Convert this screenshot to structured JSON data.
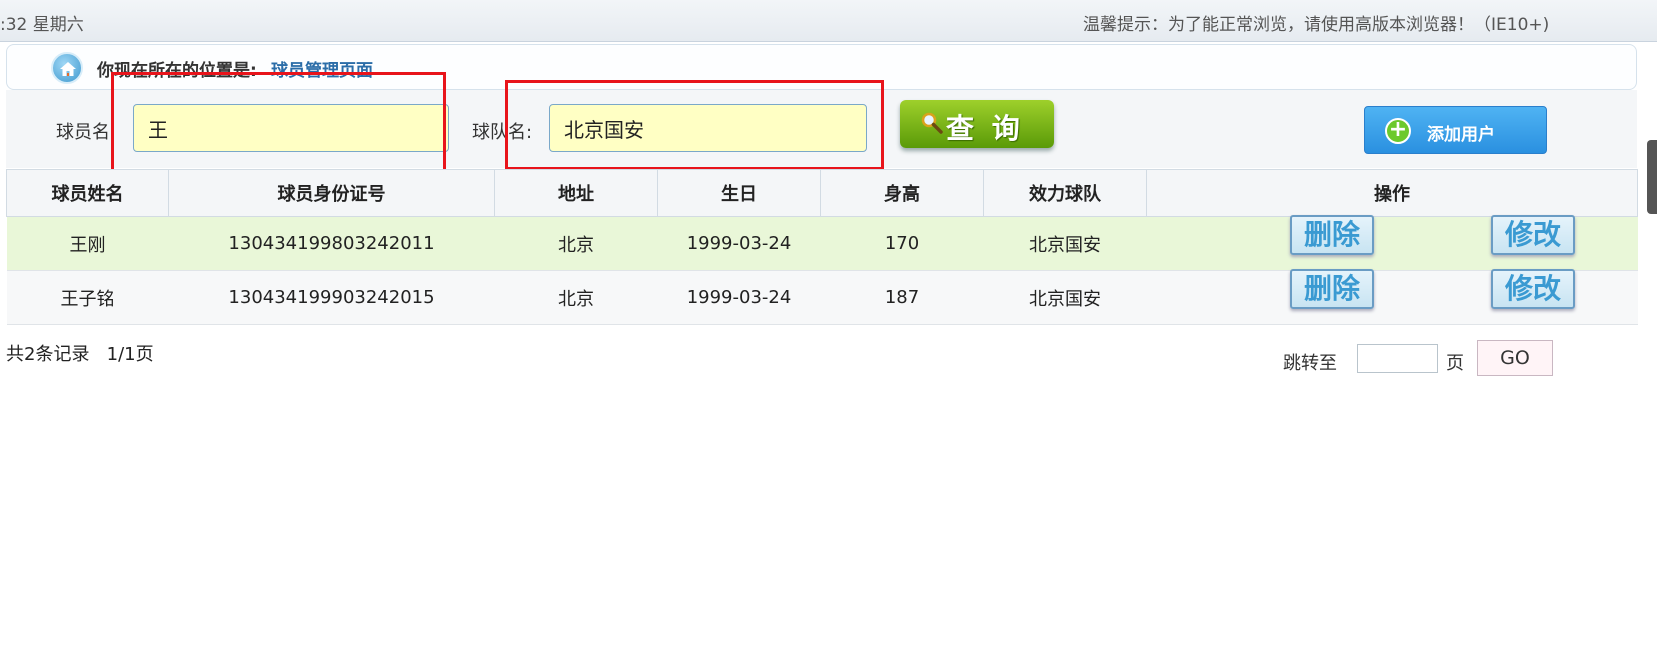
{
  "topbar": {
    "clock": ":32 星期六",
    "tip": "温馨提示：为了能正常浏览，请使用高版本浏览器！（IE10+)"
  },
  "location": {
    "label": "你现在所在的位置是:",
    "link": "球员管理页面",
    "icon": "home-icon"
  },
  "search": {
    "player_label": "球员名:",
    "player_value": "王",
    "team_label": "球队名:",
    "team_value": "北京国安",
    "query_label": "查 询",
    "add_label": "添加用户"
  },
  "table": {
    "headers": [
      "球员姓名",
      "球员身份证号",
      "地址",
      "生日",
      "身高",
      "效力球队",
      "操作"
    ],
    "rows": [
      {
        "name": "王刚",
        "id": "130434199803242011",
        "address": "北京",
        "birthday": "1999-03-24",
        "height": "170",
        "team": "北京国安"
      },
      {
        "name": "王子铭",
        "id": "130434199903242015",
        "address": "北京",
        "birthday": "1999-03-24",
        "height": "187",
        "team": "北京国安"
      }
    ],
    "delete_label": "删除",
    "edit_label": "修改"
  },
  "pager": {
    "summary": "共2条记录   1/1页",
    "jump_label": "跳转至",
    "page_label": "页",
    "go_label": "GO"
  },
  "colors": {
    "highlight_row": "#e9f7d8",
    "input_bg": "#ffffc4",
    "annotation_red": "#e8141b",
    "query_green": "#7cb81a",
    "add_blue": "#3aa2ea"
  }
}
